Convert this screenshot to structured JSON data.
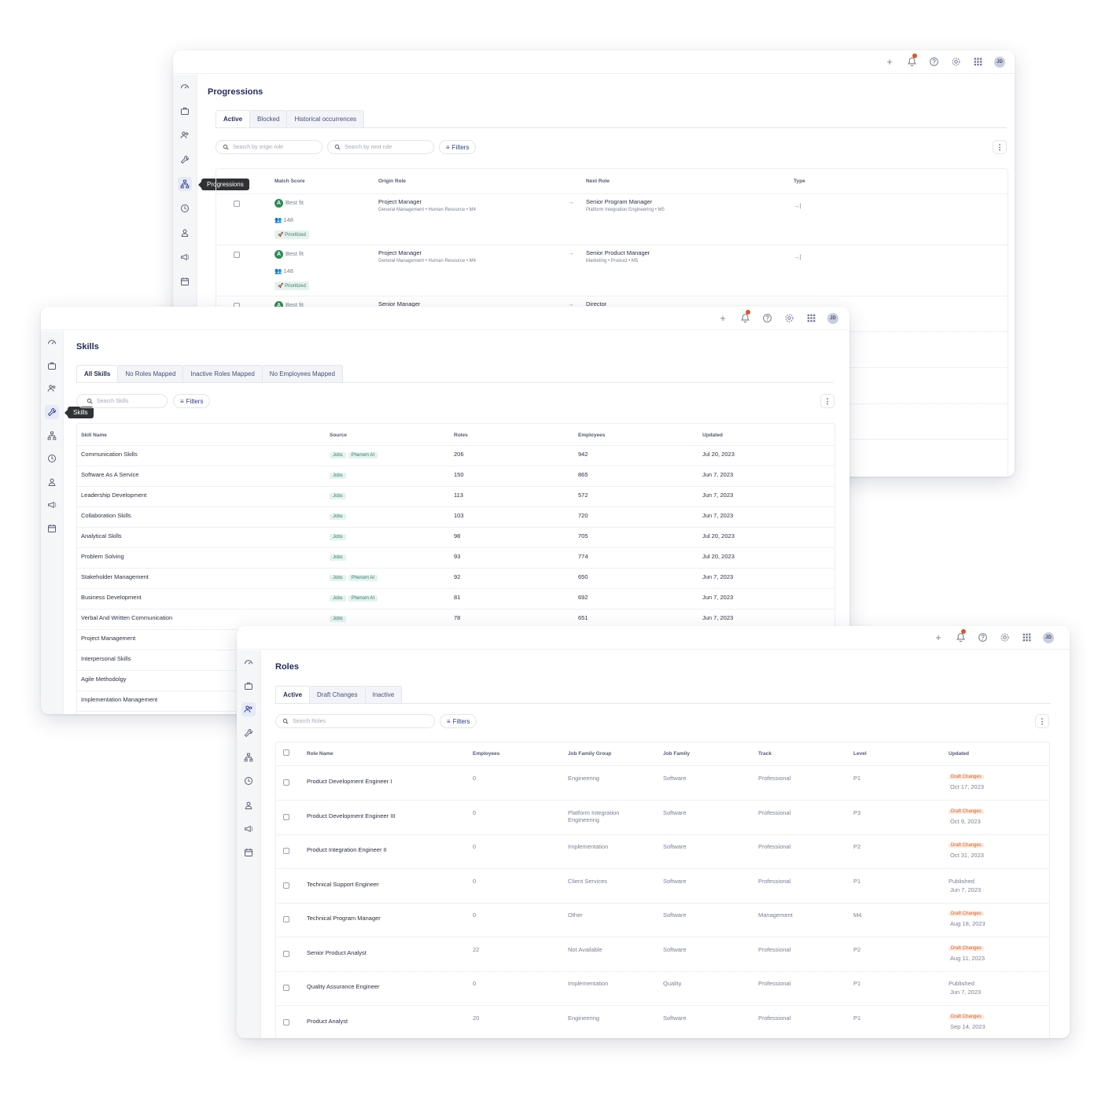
{
  "topbar": {
    "avatar_initials": "JD"
  },
  "progressions": {
    "title": "Progressions",
    "tooltip": "Progressions",
    "tabs": [
      "Active",
      "Blocked",
      "Historical occurrences"
    ],
    "search_origin_placeholder": "Search by origin role",
    "search_next_placeholder": "Search by next role",
    "filters_label": "Filters",
    "headers": {
      "match": "Match Score",
      "origin": "Origin Role",
      "next": "Next Role",
      "type": "Type"
    },
    "rows": [
      {
        "fit": "Best fit",
        "count": "148",
        "tag": "Prioritized",
        "origin": "Project Manager",
        "origin_sub": "General Management • Human Resource • M4",
        "next": "Senior Program Manager",
        "next_sub": "Platform Integration Engineering • M5"
      },
      {
        "fit": "Best fit",
        "count": "148",
        "tag": "Prioritized",
        "origin": "Project Manager",
        "origin_sub": "General Management • Human Resource • M4",
        "next": "Senior Product Manager",
        "next_sub": "Marketing • Product • M5"
      },
      {
        "fit": "Best fit",
        "origin": "Senior Manager",
        "next": "Director"
      }
    ]
  },
  "skills": {
    "title": "Skills",
    "tooltip": "Skills",
    "tabs": [
      "All Skills",
      "No Roles Mapped",
      "Inactive Roles Mapped",
      "No Employees Mapped"
    ],
    "search_placeholder": "Search Skills",
    "filters_label": "Filters",
    "headers": {
      "name": "Skill Name",
      "source": "Source",
      "roles": "Roles",
      "employees": "Employees",
      "updated": "Updated"
    },
    "rows": [
      {
        "name": "Communication Skills",
        "sources": [
          "Jobs",
          "Phenom AI"
        ],
        "roles": "206",
        "employees": "942",
        "updated": "Jul 20, 2023"
      },
      {
        "name": "Software As A Service",
        "sources": [
          "Jobs"
        ],
        "roles": "150",
        "employees": "865",
        "updated": "Jun 7, 2023"
      },
      {
        "name": "Leadership Development",
        "sources": [
          "Jobs"
        ],
        "roles": "113",
        "employees": "572",
        "updated": "Jun 7, 2023"
      },
      {
        "name": "Collaboration Skills",
        "sources": [
          "Jobs"
        ],
        "roles": "103",
        "employees": "720",
        "updated": "Jun 7, 2023"
      },
      {
        "name": "Analytical Skills",
        "sources": [
          "Jobs"
        ],
        "roles": "98",
        "employees": "705",
        "updated": "Jul 20, 2023"
      },
      {
        "name": "Problem Solving",
        "sources": [
          "Jobs"
        ],
        "roles": "93",
        "employees": "774",
        "updated": "Jul 20, 2023"
      },
      {
        "name": "Stakeholder Management",
        "sources": [
          "Jobs",
          "Phenom AI"
        ],
        "roles": "92",
        "employees": "650",
        "updated": "Jun 7, 2023"
      },
      {
        "name": "Business Development",
        "sources": [
          "Jobs",
          "Phenom AI"
        ],
        "roles": "81",
        "employees": "692",
        "updated": "Jun 7, 2023"
      },
      {
        "name": "Verbal And Written Communication",
        "sources": [
          "Jobs"
        ],
        "roles": "78",
        "employees": "651",
        "updated": "Jun 7, 2023"
      },
      {
        "name": "Project Management",
        "sources": [],
        "roles": "",
        "employees": "",
        "updated": ""
      },
      {
        "name": "Interpersonal Skills",
        "sources": [],
        "roles": "",
        "employees": "",
        "updated": ""
      },
      {
        "name": "Agile Methodolgy",
        "sources": [],
        "roles": "",
        "employees": "",
        "updated": ""
      },
      {
        "name": "Implementation Management",
        "sources": [],
        "roles": "",
        "employees": "",
        "updated": ""
      }
    ]
  },
  "roles": {
    "title": "Roles",
    "tabs": [
      "Active",
      "Draft Changes",
      "Inactive"
    ],
    "search_placeholder": "Search Roles",
    "filters_label": "Filters",
    "headers": {
      "name": "Role Name",
      "employees": "Employees",
      "group": "Job Family Group",
      "family": "Job Family",
      "track": "Track",
      "level": "Level",
      "updated": "Updated"
    },
    "rows": [
      {
        "name": "Product Development Engineer I",
        "employees": "0",
        "group": "Engineering",
        "family": "Software",
        "track": "Professional",
        "level": "P1",
        "status": "Draft Changes",
        "date": "Oct 17, 2023"
      },
      {
        "name": "Product Development Engineer III",
        "employees": "0",
        "group": "Platform Integration Engineering",
        "family": "Software",
        "track": "Professional",
        "level": "P3",
        "status": "Draft Changes",
        "date": "Oct 9, 2023"
      },
      {
        "name": "Product Integration Engineer II",
        "employees": "0",
        "group": "Implementation",
        "family": "Software",
        "track": "Professional",
        "level": "P2",
        "status": "Draft Changes",
        "date": "Oct 31, 2023"
      },
      {
        "name": "Technical Support Engineer",
        "employees": "0",
        "group": "Client Services",
        "family": "Software",
        "track": "Professional",
        "level": "P1",
        "status": "Published",
        "date": "Jun 7, 2023"
      },
      {
        "name": "Technical Program Manager",
        "employees": "0",
        "group": "Other",
        "family": "Software",
        "track": "Management",
        "level": "M4",
        "status": "Draft Changes",
        "date": "Aug 18, 2023"
      },
      {
        "name": "Senior Product Analyst",
        "employees": "22",
        "group": "Not Available",
        "family": "Software",
        "track": "Professional",
        "level": "P2",
        "status": "Draft Changes",
        "date": "Aug 11, 2023"
      },
      {
        "name": "Quality Assurance Engineer",
        "employees": "0",
        "group": "Implementation",
        "family": "Quality",
        "track": "Professional",
        "level": "P1",
        "status": "Published",
        "date": "Jun 7, 2023"
      },
      {
        "name": "Product Analyst",
        "employees": "20",
        "group": "Engineering",
        "family": "Software",
        "track": "Professional",
        "level": "P1",
        "status": "Draft Changes",
        "date": "Sep 14, 2023"
      }
    ]
  },
  "colors": {
    "accent": "#1f2a5c",
    "draft": "#d2642c",
    "success": "#2e8b57"
  }
}
